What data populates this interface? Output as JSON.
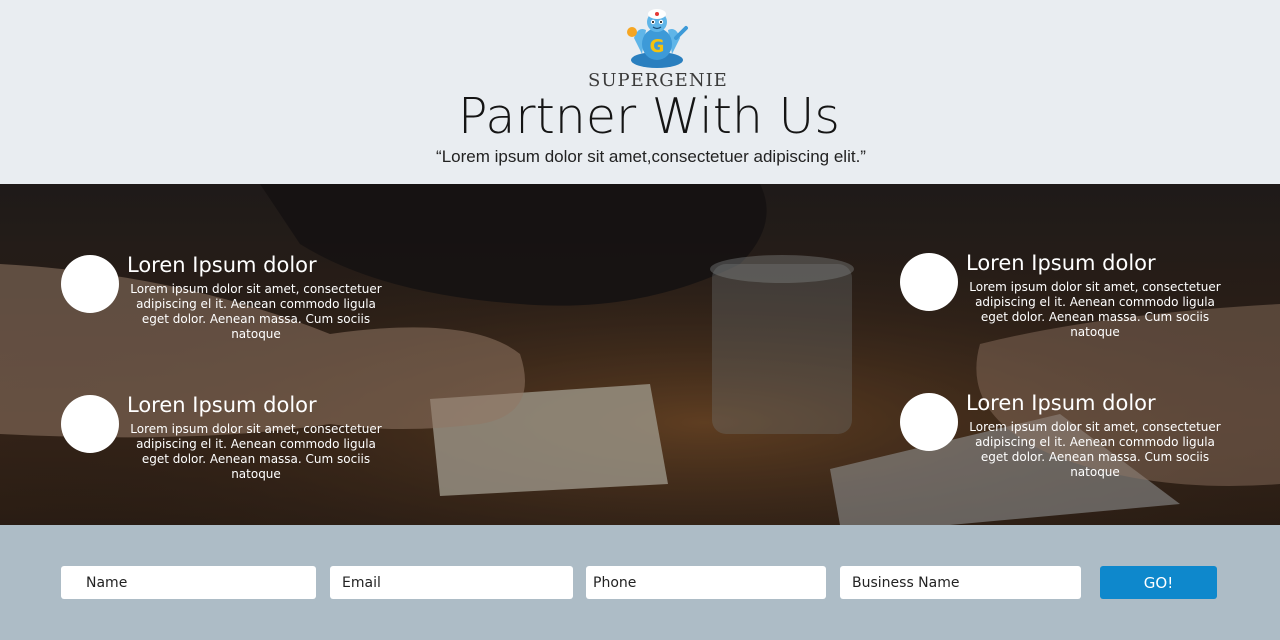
{
  "brand": {
    "logo_text": "SUPERGENIE"
  },
  "header": {
    "title": "Partner With Us",
    "subtitle": "“Lorem ipsum dolor sit amet,consectetuer adipiscing elit.”"
  },
  "features": [
    {
      "title": "Loren Ipsum dolor",
      "text": "Lorem ipsum dolor sit amet, consectetuer adipiscing el it. Aenean commodo ligula eget dolor. Aenean  massa. Cum sociis natoque"
    },
    {
      "title": "Loren Ipsum dolor",
      "text": "Lorem ipsum dolor sit amet, consectetuer adipiscing el it. Aenean commodo ligula eget dolor. Aenean  massa. Cum sociis natoque"
    },
    {
      "title": "Loren Ipsum dolor",
      "text": "Lorem ipsum dolor sit amet, consectetuer adipiscing el it. Aenean commodo ligula eget dolor. Aenean  massa. Cum sociis natoque"
    },
    {
      "title": "Loren Ipsum dolor",
      "text": "Lorem ipsum dolor sit amet, consectetuer adipiscing el it. Aenean commodo ligula eget dolor. Aenean  massa. Cum sociis natoque"
    }
  ],
  "form": {
    "name_placeholder": "Name",
    "email_placeholder": "Email",
    "phone_placeholder": "Phone",
    "business_placeholder": "Business Name",
    "submit_label": "GO!"
  },
  "colors": {
    "header_bg": "#e9edf1",
    "form_bg": "#adbcc6",
    "button_bg": "#0e88cc"
  },
  "icons": {
    "logo": "genie-mascot-icon"
  }
}
